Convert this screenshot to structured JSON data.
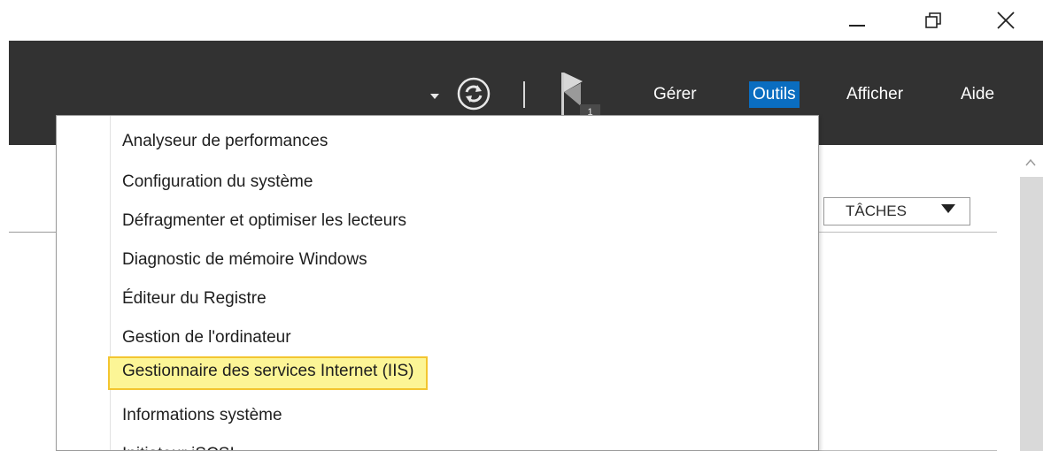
{
  "window": {
    "controls": {
      "minimize_icon": "minimize-icon",
      "restore_icon": "restore-icon",
      "close_icon": "close-icon"
    }
  },
  "header": {
    "notification_count": "1",
    "menu": {
      "manage": "Gérer",
      "tools": "Outils",
      "view": "Afficher",
      "help": "Aide"
    },
    "colors": {
      "bar": "#323232",
      "active_menu": "#0a6dc0"
    }
  },
  "content": {
    "tasks_button": "TÂCHES"
  },
  "tools_menu": {
    "items": [
      "Analyseur de performances",
      "Configuration du système",
      "Défragmenter et optimiser les lecteurs",
      "Diagnostic de mémoire Windows",
      "Éditeur du Registre",
      "Gestion de l'ordinateur",
      "Gestionnaire des services Internet (IIS)",
      "Informations système",
      "Initiateur iSCSI"
    ],
    "highlighted_item": "Gestionnaire des services Internet (IIS)",
    "colors": {
      "highlight_fill": "#fcf596",
      "highlight_border": "#f3c530"
    }
  }
}
